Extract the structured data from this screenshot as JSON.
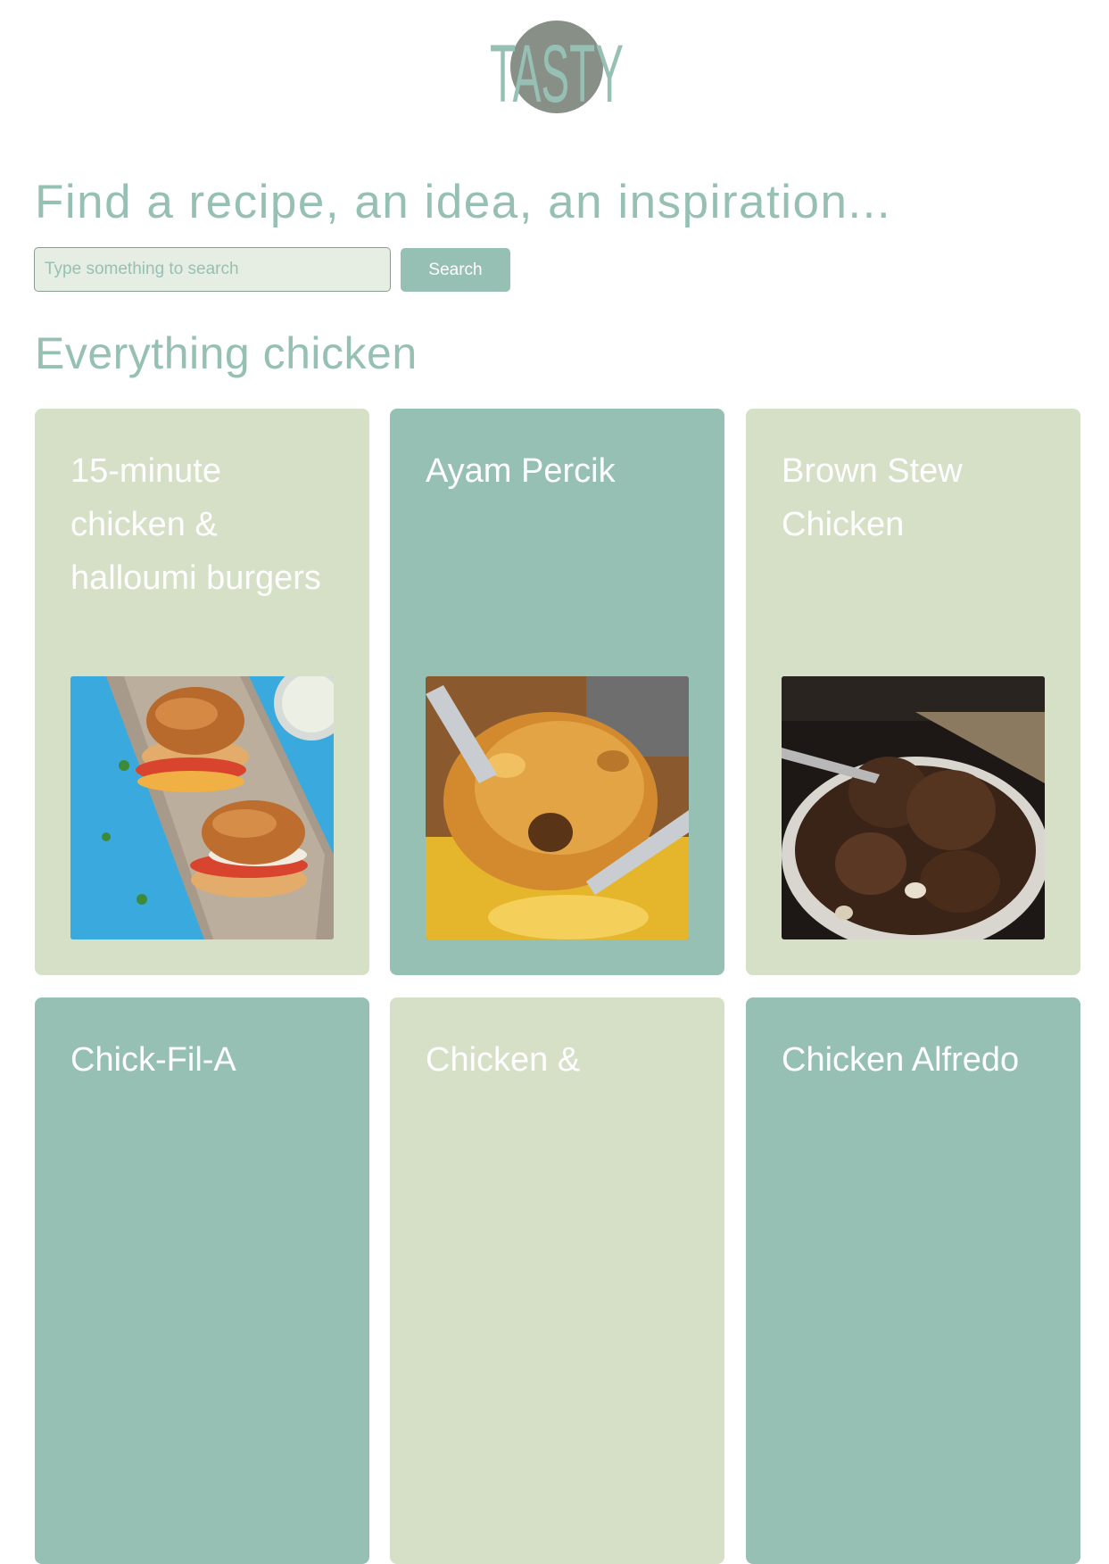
{
  "logo": {
    "text": "TASTY",
    "colors": {
      "letters": "#97c0b5",
      "circle": "#878f87"
    }
  },
  "hero": {
    "tagline": "Find a recipe, an idea, an inspiration..."
  },
  "search": {
    "placeholder": "Type something to search",
    "value": "",
    "button_label": "Search"
  },
  "section": {
    "title": "Everything chicken"
  },
  "colors": {
    "accent": "#97c0b5",
    "card_light": "#d5e0c7",
    "input_bg": "#e6eee3",
    "white": "#ffffff"
  },
  "recipes": [
    {
      "title": "15-minute chicken & halloumi burgers",
      "image": "burgers-photo"
    },
    {
      "title": "Ayam Percik",
      "image": "grilled-chicken-photo"
    },
    {
      "title": "Brown Stew Chicken",
      "image": "stew-chicken-photo"
    },
    {
      "title": "Chick-Fil-A",
      "image": ""
    },
    {
      "title": "Chicken &",
      "image": ""
    },
    {
      "title": "Chicken Alfredo",
      "image": ""
    }
  ]
}
